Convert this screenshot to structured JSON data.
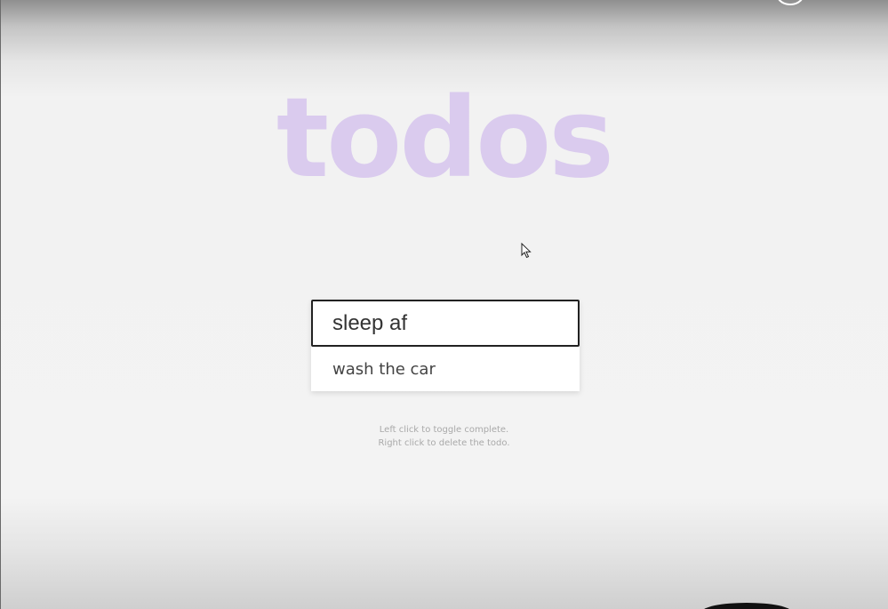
{
  "app": {
    "title": "todos"
  },
  "input": {
    "value": "sleep af",
    "placeholder": ""
  },
  "todos": [
    {
      "label": "wash the car",
      "completed": false
    }
  ],
  "hints": {
    "line1": "Left click to toggle complete.",
    "line2": "Right click to delete the todo."
  },
  "colors": {
    "title": "#dacbee",
    "input_border": "#222222",
    "hint_text": "#a9a9a9"
  },
  "icons": {
    "cursor": "mouse-pointer-icon",
    "avatar": "avatar-icon"
  }
}
